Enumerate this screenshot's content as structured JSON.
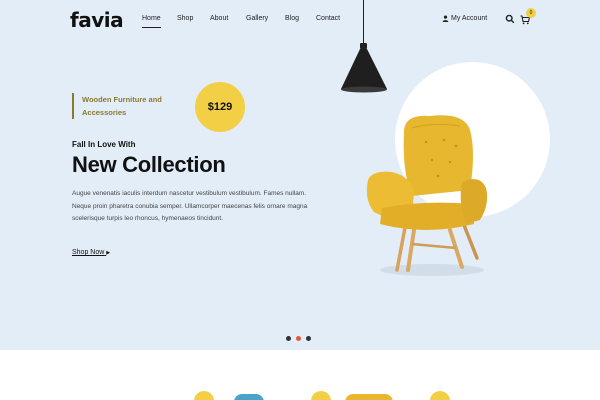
{
  "brand": {
    "logo": "favia"
  },
  "nav": {
    "items": [
      {
        "label": "Home",
        "active": true
      },
      {
        "label": "Shop",
        "active": false
      },
      {
        "label": "About",
        "active": false
      },
      {
        "label": "Gallery",
        "active": false
      },
      {
        "label": "Blog",
        "active": false
      },
      {
        "label": "Contact",
        "active": false
      }
    ]
  },
  "header": {
    "account_label": "My Account",
    "account_icon": "user-icon",
    "search_icon": "search-icon",
    "cart_icon": "cart-icon",
    "cart_count": "0"
  },
  "hero": {
    "tag_line1": "Wooden Furniture and",
    "tag_line2": "Accessories",
    "price": "$129",
    "subtitle": "Fall In Love With",
    "title": "New Collection",
    "description": "Augue venenatis iaculis interdum nascetur vestibulum vestibulum. Fames nullam. Neque proin pharetra conubia semper. Ullamcorper maecenas felis ornare magna scelerisque turpis leo rhoncus, hymenaeos tincidunt.",
    "cta": "Shop Now"
  },
  "slider": {
    "count": 3,
    "active_index": 1
  },
  "colors": {
    "hero_bg": "#e3edf8",
    "accent_yellow": "#f2cf45",
    "tag_olive": "#8a7a2e",
    "chair_yellow": "#e8b730",
    "active_dot": "#e05a3a"
  }
}
